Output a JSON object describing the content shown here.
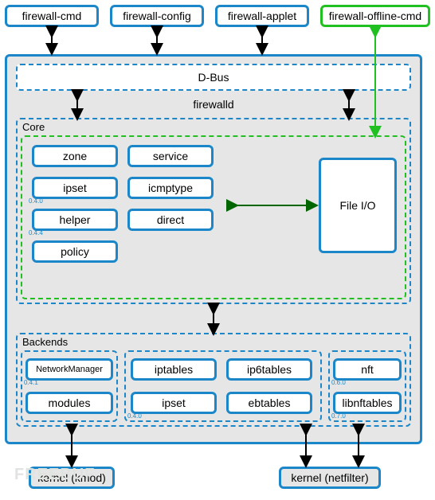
{
  "top": {
    "cmd": "firewall-cmd",
    "config": "firewall-config",
    "applet": "firewall-applet",
    "offline": "firewall-offline-cmd"
  },
  "dbus": "D-Bus",
  "firewalld": "firewalld",
  "core": {
    "title": "Core",
    "zone": "zone",
    "service": "service",
    "ipset": "ipset",
    "ipset_v": "0.4.0",
    "icmptype": "icmptype",
    "helper": "helper",
    "helper_v": "0.4.4",
    "direct": "direct",
    "policy": "policy",
    "fileio": "File I/O"
  },
  "backends": {
    "title": "Backends",
    "nm": "NetworkManager",
    "nm_v": "0.4.1",
    "iptables": "iptables",
    "ip6tables": "ip6tables",
    "nft": "nft",
    "nft_v": "0.6.0",
    "modules": "modules",
    "ipset": "ipset",
    "ipset_v": "0.4.0",
    "ebtables": "ebtables",
    "libnftables": "libnftables",
    "libnf_v": "0.7.0"
  },
  "kernel": {
    "kmod": "kernel (kmod)",
    "netfilter": "kernel (netfilter)"
  },
  "watermark": "FREEBUF"
}
